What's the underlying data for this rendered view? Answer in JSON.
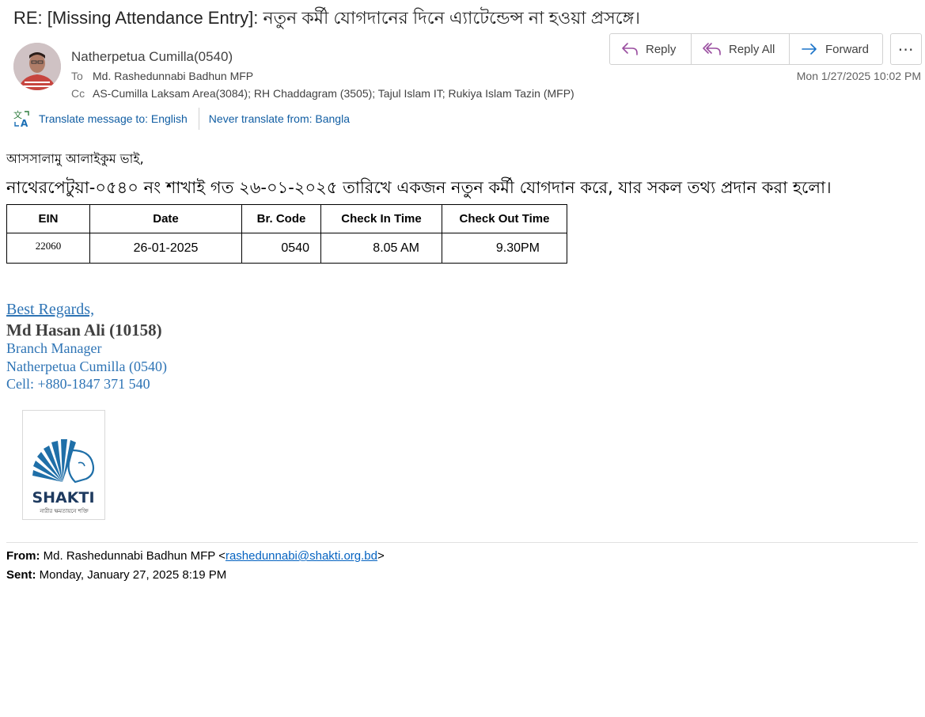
{
  "email": {
    "subject": "RE: [Missing Attendance Entry]: নতুন কর্মী যোগদানের দিনে এ্যাটেন্ডেন্স না হওয়া প্রসঙ্গে।",
    "sender": "Natherpetua Cumilla(0540)",
    "to_label": "To",
    "to": "Md. Rashedunnabi Badhun MFP",
    "cc_label": "Cc",
    "cc": "AS-Cumilla Laksam Area(3084); RH Chaddagram (3505); Tajul Islam IT; Rukiya Islam Tazin (MFP)",
    "datetime": "Mon 1/27/2025 10:02 PM"
  },
  "actions": {
    "reply": "Reply",
    "reply_all": "Reply All",
    "forward": "Forward",
    "more": "⋯"
  },
  "translate": {
    "translate_to": "Translate message to: English",
    "never_translate": "Never translate from: Bangla"
  },
  "body": {
    "greeting": "আসসালামু আলাইকুম ভাই,",
    "intro": "নাথেরপেটুয়া-০৫৪০ নং শাখাই গত ২৬-০১-২০২৫ তারিখে একজন নতুন কর্মী যোগদান করে, যার সকল তথ্য প্রদান করা হলো।"
  },
  "table": {
    "headers": [
      "EIN",
      "Date",
      "Br. Code",
      "Check In Time",
      "Check Out Time"
    ],
    "rows": [
      [
        "22060",
        "26-01-2025",
        "0540",
        "8.05 AM",
        "9.30PM"
      ]
    ]
  },
  "signature": {
    "regards": "Best Regards,",
    "name": "Md Hasan Ali (10158)",
    "title": "Branch Manager",
    "branch": "Natherpetua Cumilla (0540)",
    "cell": "Cell: +880-1847 371 540",
    "logo_text": "SHAKTI",
    "logo_tagline": "নারীর ক্ষমতায়নে শক্তি"
  },
  "quoted": {
    "from_label": "From:",
    "from_name": "Md. Rashedunnabi Badhun MFP <",
    "from_email": "rashedunnabi@shakti.org.bd",
    "from_close": ">",
    "sent_label": "Sent:",
    "sent_value": "Monday, January 27, 2025 8:19 PM"
  },
  "colors": {
    "link_blue": "#115ea3",
    "signature_blue": "#2e74b5",
    "logo_blue": "#1f6fa8"
  }
}
